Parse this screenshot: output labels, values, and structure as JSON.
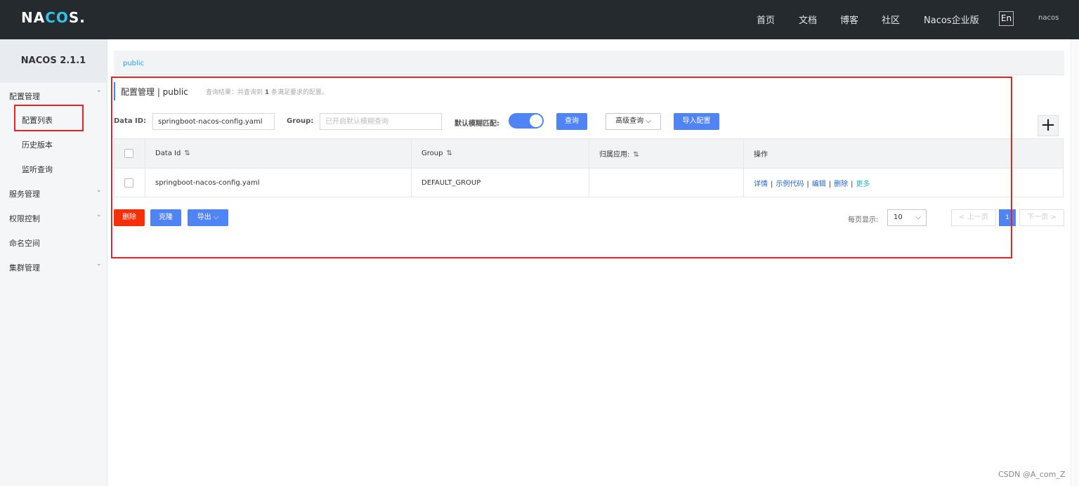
{
  "header": {
    "logo_main": "NA",
    "logo_accent": "CO",
    "logo_tail": "S.",
    "nav": [
      "首页",
      "文档",
      "博客",
      "社区",
      "Nacos企业版"
    ],
    "lang": "En",
    "user": "nacos"
  },
  "sidebar": {
    "version": "NACOS 2.1.1",
    "config_mgmt": "配置管理",
    "config_list": "配置列表",
    "history": "历史版本",
    "listener": "监听查询",
    "service_mgmt": "服务管理",
    "auth_ctrl": "权限控制",
    "namespace": "命名空间",
    "cluster_mgmt": "集群管理"
  },
  "namespace_bar": {
    "current": "public"
  },
  "page": {
    "title": "配置管理  |  public",
    "result_prefix": "查询结果：共查询到",
    "result_count": "1",
    "result_suffix": "条满足要求的配置。"
  },
  "search": {
    "data_id_label": "Data ID:",
    "data_id_value": "springboot-nacos-config.yaml",
    "group_label": "Group:",
    "group_placeholder": "已开启默认模糊查询",
    "fuzzy_label": "默认模糊匹配:",
    "query_btn": "查询",
    "advanced_btn": "高级查询",
    "import_btn": "导入配置"
  },
  "table": {
    "headers": [
      "Data Id",
      "Group",
      "归属应用:",
      "操作"
    ],
    "rows": [
      {
        "data_id": "springboot-nacos-config.yaml",
        "group": "DEFAULT_GROUP",
        "app": "",
        "ops": [
          "详情",
          "示例代码",
          "编辑",
          "删除",
          "更多"
        ]
      }
    ]
  },
  "footer": {
    "delete_btn": "删除",
    "clone_btn": "克隆",
    "export_btn": "导出",
    "page_size_label": "每页显示:",
    "page_size": "10",
    "prev": "< 上一页",
    "current_page": "1",
    "next": "下一页 >"
  },
  "watermark": "CSDN @A_com_Z",
  "colors": {
    "topbar": "#252a2f",
    "primary": "#5084f5",
    "danger": "#f52f08",
    "annotation": "#ea2222"
  }
}
